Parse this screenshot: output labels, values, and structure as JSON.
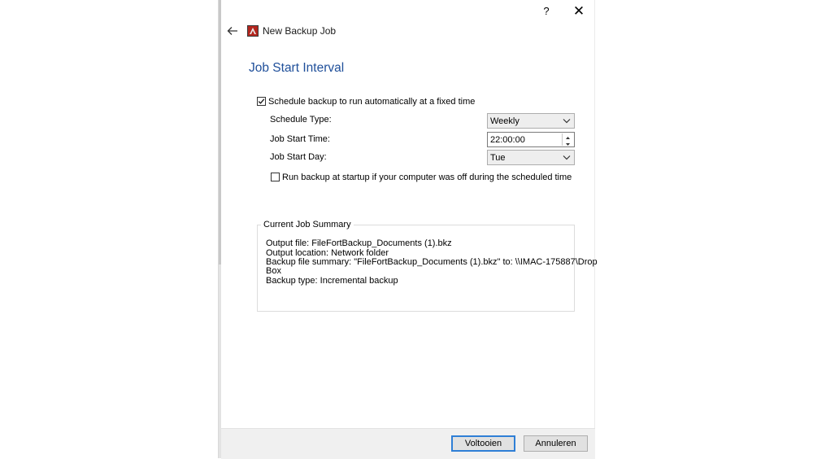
{
  "window": {
    "title": "New Backup Job",
    "help_label": "?",
    "close_label": "✕"
  },
  "page": {
    "heading": "Job Start Interval"
  },
  "schedule": {
    "enabled_label": "Schedule backup to run automatically at a fixed time",
    "enabled": true,
    "type_label": "Schedule Type:",
    "type_value": "Weekly",
    "time_label": "Job Start Time:",
    "time_value": "22:00:00",
    "day_label": "Job Start Day:",
    "day_value": "Tue",
    "startup_label": "Run backup at startup if your computer was off during the scheduled time",
    "startup_enabled": false
  },
  "summary": {
    "title": "Current Job Summary",
    "lines": [
      "Output file: FileFortBackup_Documents (1).bkz",
      "Output location: Network folder",
      "Backup file summary: \"FileFortBackup_Documents (1).bkz\" to: \\\\IMAC-175887\\Drop",
      "Box",
      "Backup type: Incremental backup"
    ]
  },
  "buttons": {
    "finish_label": "Voltooien",
    "cancel_label": "Annuleren"
  },
  "colors": {
    "heading": "#1f4f9a",
    "primary_border": "#2f7fd6",
    "icon_red": "#b3261e"
  },
  "icons": {
    "back": "back-arrow-icon",
    "app": "app-icon",
    "close": "close-icon",
    "help": "help-icon",
    "dropdown": "chevron-down-icon",
    "spin": "spin-arrows-icon"
  }
}
